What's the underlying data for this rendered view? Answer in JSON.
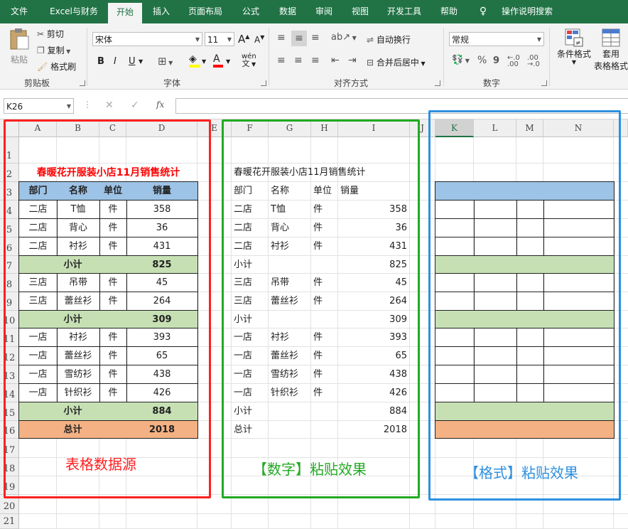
{
  "tabs": [
    "文件",
    "Excel与财务",
    "开始",
    "插入",
    "页面布局",
    "公式",
    "数据",
    "审阅",
    "视图",
    "开发工具",
    "帮助",
    "操作说明搜索"
  ],
  "ribbon": {
    "clipboard": {
      "paste": "粘贴",
      "cut": "剪切",
      "copy": "复制",
      "format_painter": "格式刷",
      "label": "剪贴板"
    },
    "font": {
      "name": "宋体",
      "size": "11",
      "bold": "B",
      "italic": "I",
      "underline": "U",
      "label": "字体",
      "grow": "A",
      "shrink": "A",
      "phonetic": "wén"
    },
    "align": {
      "wrap": "自动换行",
      "merge": "合并后居中",
      "label": "对齐方式"
    },
    "number": {
      "format": "常规",
      "percent": "%",
      "comma": "9",
      "label": "数字"
    },
    "styles": {
      "cond": "条件格式",
      "table1": "套用",
      "table2": "表格格式"
    }
  },
  "formula_bar": {
    "name_box": "K26",
    "cancel": "✕",
    "enter": "✓",
    "fx": "fx",
    "value": ""
  },
  "columns": [
    "A",
    "B",
    "C",
    "D",
    "E",
    "F",
    "G",
    "H",
    "I",
    "J",
    "K",
    "L",
    "M",
    "N"
  ],
  "rows": [
    "1",
    "2",
    "3",
    "4",
    "5",
    "6",
    "7",
    "8",
    "9",
    "10",
    "11",
    "12",
    "13",
    "14",
    "15",
    "16",
    "17",
    "18",
    "19",
    "20",
    "21"
  ],
  "title": "春暖花开服装小店11月销售统计",
  "headers": [
    "部门",
    "名称",
    "单位",
    "销量"
  ],
  "records": [
    {
      "type": "data",
      "dept": "二店",
      "name": "T恤",
      "unit": "件",
      "qty": "358"
    },
    {
      "type": "data",
      "dept": "二店",
      "name": "背心",
      "unit": "件",
      "qty": "36"
    },
    {
      "type": "data",
      "dept": "二店",
      "name": "衬衫",
      "unit": "件",
      "qty": "431"
    },
    {
      "type": "sub",
      "label": "小计",
      "qty": "825"
    },
    {
      "type": "data",
      "dept": "三店",
      "name": "吊带",
      "unit": "件",
      "qty": "45"
    },
    {
      "type": "data",
      "dept": "三店",
      "name": "蕾丝衫",
      "unit": "件",
      "qty": "264"
    },
    {
      "type": "sub",
      "label": "小计",
      "qty": "309"
    },
    {
      "type": "data",
      "dept": "一店",
      "name": "衬衫",
      "unit": "件",
      "qty": "393"
    },
    {
      "type": "data",
      "dept": "一店",
      "name": "蕾丝衫",
      "unit": "件",
      "qty": "65"
    },
    {
      "type": "data",
      "dept": "一店",
      "name": "雪纺衫",
      "unit": "件",
      "qty": "438"
    },
    {
      "type": "data",
      "dept": "一店",
      "name": "针织衫",
      "unit": "件",
      "qty": "426"
    },
    {
      "type": "sub",
      "label": "小计",
      "qty": "884"
    },
    {
      "type": "total",
      "label": "总计",
      "qty": "2018"
    }
  ],
  "annotations": {
    "source": "表格数据源",
    "values": "【数字】粘贴效果",
    "formats": "【格式】粘贴效果"
  },
  "colors": {
    "header": "#9dc3e6",
    "subtotal": "#c6e0b4",
    "total": "#f4b183",
    "title": "#ff0000",
    "red": "#ff2020",
    "green": "#22aa22",
    "blue": "#2e90e0",
    "brand": "#217346"
  }
}
